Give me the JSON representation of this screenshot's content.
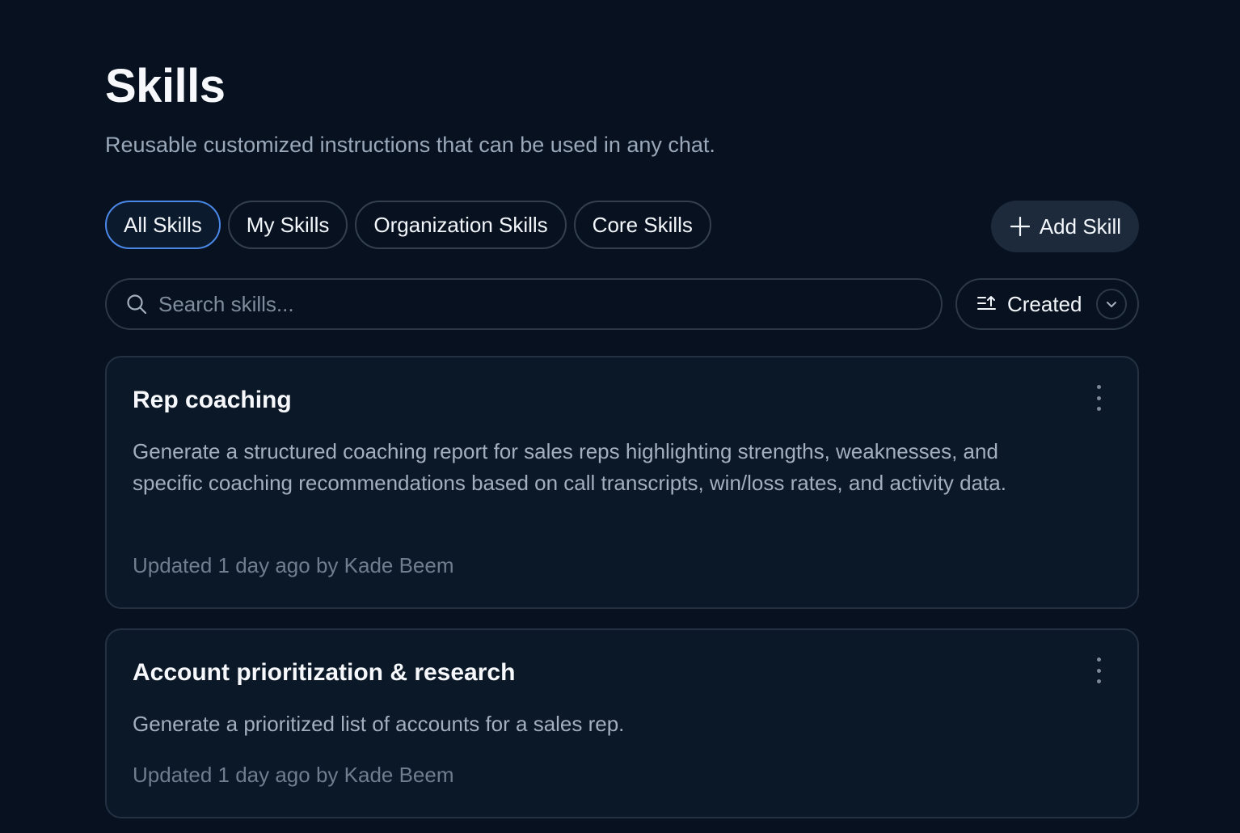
{
  "header": {
    "title": "Skills",
    "subtitle": "Reusable customized instructions that can be used in any chat."
  },
  "tabs": [
    {
      "label": "All Skills",
      "active": true
    },
    {
      "label": "My Skills",
      "active": false
    },
    {
      "label": "Organization Skills",
      "active": false
    },
    {
      "label": "Core Skills",
      "active": false
    }
  ],
  "add_button": {
    "label": "Add Skill",
    "icon": "plus-icon"
  },
  "search": {
    "placeholder": "Search skills...",
    "value": "",
    "icon": "search-icon"
  },
  "sort": {
    "label": "Created",
    "icon": "sort-ascending-icon",
    "dropdown_icon": "chevron-down-icon"
  },
  "skills": [
    {
      "title": "Rep coaching",
      "description": "Generate a structured coaching report for sales reps highlighting strengths, weaknesses, and specific coaching recommendations based on call transcripts, win/loss rates, and activity data.",
      "meta": "Updated 1 day ago by Kade Beem"
    },
    {
      "title": "Account prioritization & research",
      "description": "Generate a prioritized list of accounts for a sales rep.",
      "meta": "Updated 1 day ago by Kade Beem"
    }
  ],
  "colors": {
    "background": "#07111f",
    "card": "#0b1828",
    "accent": "#4a88e8",
    "border": "#2d3948"
  }
}
